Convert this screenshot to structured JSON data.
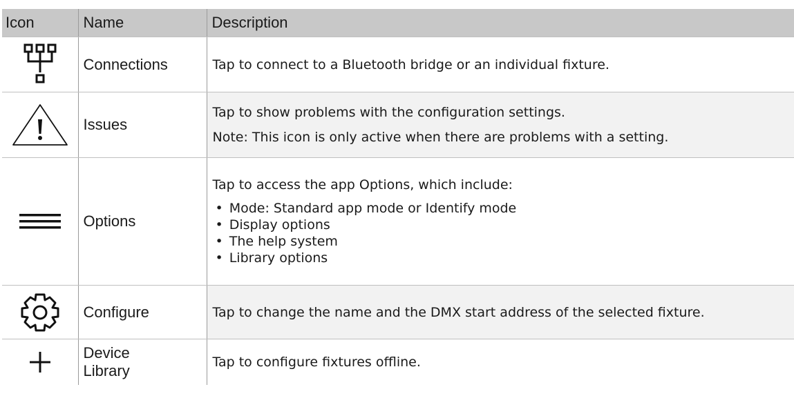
{
  "table": {
    "headers": {
      "icon": "Icon",
      "name": "Name",
      "description": "Description"
    },
    "rows": [
      {
        "icon": "connections-icon",
        "name": "Connections",
        "description": [
          "Tap to connect to a Bluetooth bridge or an individual fixture."
        ]
      },
      {
        "icon": "warning-triangle-icon",
        "name": "Issues",
        "description": [
          "Tap to show problems with the configuration settings.",
          "Note: This icon is only active when there are problems with a setting."
        ]
      },
      {
        "icon": "hamburger-menu-icon",
        "name": "Options",
        "description": [
          "Tap to access the app Options, which include:"
        ],
        "bullets": [
          "Mode: Standard app mode or Identify mode",
          "Display options",
          "The help system",
          "Library options"
        ]
      },
      {
        "icon": "gear-icon",
        "name": "Configure",
        "description": [
          "Tap to change the name and the DMX start address of the selected fixture."
        ]
      },
      {
        "icon": "plus-icon",
        "name": "Device Library",
        "description": [
          "Tap to configure fixtures offline."
        ]
      }
    ]
  },
  "colors": {
    "header_bg": "#c8c8c8",
    "shaded_row_bg": "#f2f2f2",
    "text": "#1a1a1a"
  }
}
